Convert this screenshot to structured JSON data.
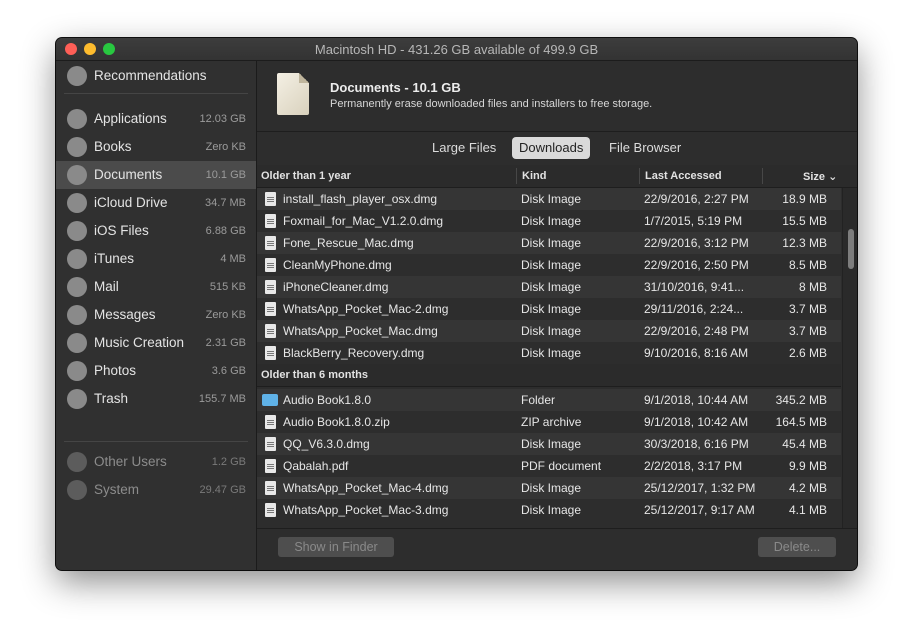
{
  "window": {
    "title": "Macintosh HD - 431.26 GB available of 499.9 GB"
  },
  "sidebar": {
    "recommendations": "Recommendations",
    "items": [
      {
        "label": "Applications",
        "size": "12.03 GB",
        "icon": "app-store-icon"
      },
      {
        "label": "Books",
        "size": "Zero KB",
        "icon": "books-icon"
      },
      {
        "label": "Documents",
        "size": "10.1 GB",
        "icon": "document-icon",
        "active": true
      },
      {
        "label": "iCloud Drive",
        "size": "34.7 MB",
        "icon": "cloud-icon"
      },
      {
        "label": "iOS Files",
        "size": "6.88 GB",
        "icon": "iphone-icon"
      },
      {
        "label": "iTunes",
        "size": "4 MB",
        "icon": "music-note-icon"
      },
      {
        "label": "Mail",
        "size": "515 KB",
        "icon": "mail-icon"
      },
      {
        "label": "Messages",
        "size": "Zero KB",
        "icon": "messages-icon"
      },
      {
        "label": "Music Creation",
        "size": "2.31 GB",
        "icon": "guitar-icon"
      },
      {
        "label": "Photos",
        "size": "3.6 GB",
        "icon": "photos-icon"
      },
      {
        "label": "Trash",
        "size": "155.7 MB",
        "icon": "trash-icon"
      }
    ],
    "other_users": {
      "label": "Other Users",
      "size": "1.2 GB"
    },
    "system": {
      "label": "System",
      "size": "29.47 GB"
    }
  },
  "header": {
    "title": "Documents - 10.1 GB",
    "subtitle": "Permanently erase downloaded files and installers to free storage."
  },
  "tabs": [
    "Large Files",
    "Downloads",
    "File Browser"
  ],
  "columns": {
    "name": "Older than 1 year",
    "kind": "Kind",
    "accessed": "Last Accessed",
    "size": "Size"
  },
  "groups": [
    {
      "label": "Older than 1 year",
      "rows": [
        {
          "name": "install_flash_player_osx.dmg",
          "kind": "Disk Image",
          "accessed": "22/9/2016, 2:27 PM",
          "size": "18.9 MB"
        },
        {
          "name": "Foxmail_for_Mac_V1.2.0.dmg",
          "kind": "Disk Image",
          "accessed": "1/7/2015, 5:19 PM",
          "size": "15.5 MB"
        },
        {
          "name": "Fone_Rescue_Mac.dmg",
          "kind": "Disk Image",
          "accessed": "22/9/2016, 3:12 PM",
          "size": "12.3 MB"
        },
        {
          "name": "CleanMyPhone.dmg",
          "kind": "Disk Image",
          "accessed": "22/9/2016, 2:50 PM",
          "size": "8.5 MB"
        },
        {
          "name": "iPhoneCleaner.dmg",
          "kind": "Disk Image",
          "accessed": "31/10/2016, 9:41...",
          "size": "8 MB"
        },
        {
          "name": "WhatsApp_Pocket_Mac-2.dmg",
          "kind": "Disk Image",
          "accessed": "29/11/2016, 2:24...",
          "size": "3.7 MB"
        },
        {
          "name": "WhatsApp_Pocket_Mac.dmg",
          "kind": "Disk Image",
          "accessed": "22/9/2016, 2:48 PM",
          "size": "3.7 MB"
        },
        {
          "name": "BlackBerry_Recovery.dmg",
          "kind": "Disk Image",
          "accessed": "9/10/2016, 8:16 AM",
          "size": "2.6 MB"
        }
      ]
    },
    {
      "label": "Older than 6 months",
      "rows": [
        {
          "name": "Audio Book1.8.0",
          "kind": "Folder",
          "accessed": "9/1/2018, 10:44 AM",
          "size": "345.2 MB",
          "folder": true
        },
        {
          "name": "Audio Book1.8.0.zip",
          "kind": "ZIP archive",
          "accessed": "9/1/2018, 10:42 AM",
          "size": "164.5 MB"
        },
        {
          "name": "QQ_V6.3.0.dmg",
          "kind": "Disk Image",
          "accessed": "30/3/2018, 6:16 PM",
          "size": "45.4 MB"
        },
        {
          "name": "Qabalah.pdf",
          "kind": "PDF document",
          "accessed": "2/2/2018, 3:17 PM",
          "size": "9.9 MB"
        },
        {
          "name": "WhatsApp_Pocket_Mac-4.dmg",
          "kind": "Disk Image",
          "accessed": "25/12/2017, 1:32 PM",
          "size": "4.2 MB"
        },
        {
          "name": "WhatsApp_Pocket_Mac-3.dmg",
          "kind": "Disk Image",
          "accessed": "25/12/2017, 9:17 AM",
          "size": "4.1 MB"
        }
      ]
    }
  ],
  "footer": {
    "show_in_finder": "Show in Finder",
    "delete": "Delete..."
  }
}
